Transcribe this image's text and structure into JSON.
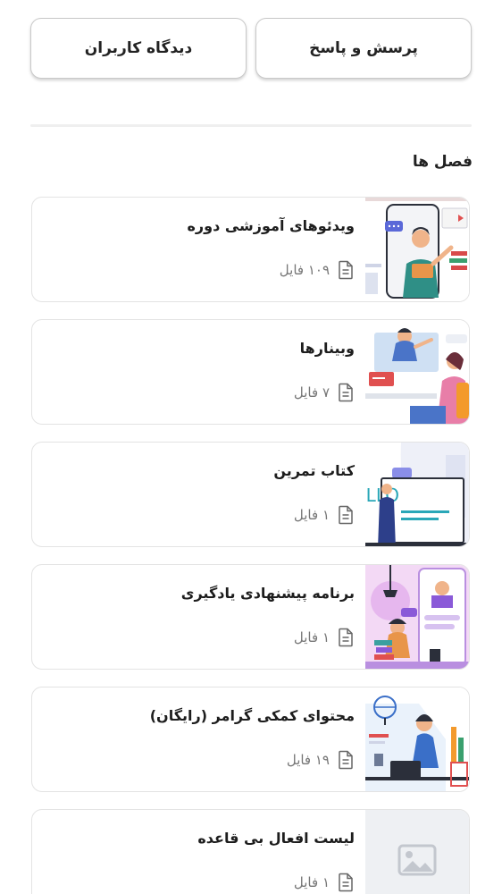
{
  "header": {
    "qa_label": "پرسش و پاسخ",
    "reviews_label": "دیدگاه کاربران"
  },
  "chapters": {
    "title": "فصل ها",
    "items": [
      {
        "title": "ویدئوهای آموزشی دوره",
        "files": "۱۰۹ فایل",
        "thumb_icon": "video-lesson-illustration"
      },
      {
        "title": "وبینارها",
        "files": "۷ فایل",
        "thumb_icon": "webinar-illustration"
      },
      {
        "title": "کتاب تمرین",
        "files": "۱ فایل",
        "thumb_icon": "hello-board-illustration"
      },
      {
        "title": "برنامه پیشنهادی یادگیری",
        "files": "۱ فایل",
        "thumb_icon": "learning-plan-illustration"
      },
      {
        "title": "محتوای کمکی گرامر (رایگان)",
        "files": "۱۹ فایل",
        "thumb_icon": "grammar-study-illustration"
      },
      {
        "title": "لیست افعال بی قاعده",
        "files": "۱ فایل",
        "thumb_icon": "image-placeholder-icon"
      }
    ]
  },
  "colors": {
    "border": "#e3e3e3",
    "meta_text": "#777777",
    "title_text": "#1d1d1d"
  }
}
